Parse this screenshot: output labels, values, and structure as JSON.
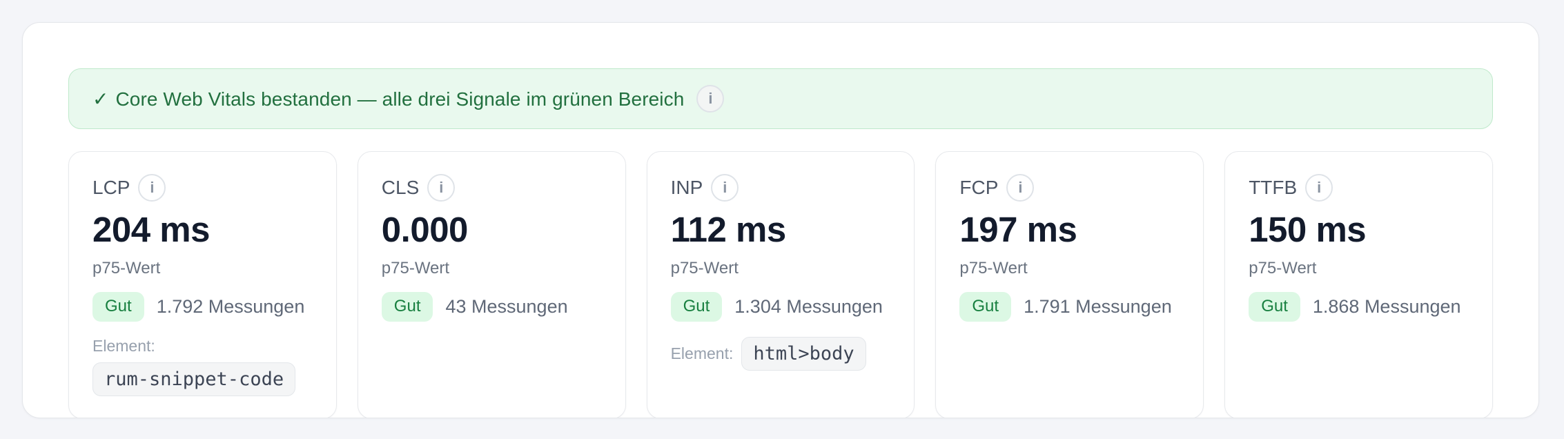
{
  "banner": {
    "check_icon": "✓",
    "text": "Core Web Vitals bestanden — alle drei Signale im grünen Bereich",
    "info_icon": "i"
  },
  "colors": {
    "page_background": "#f4f5f9",
    "panel_background": "#ffffff",
    "panel_border": "#e4e6ea",
    "banner_background": "#e9f9ee",
    "banner_border": "#bfe9cb",
    "banner_text": "#22703f",
    "badge_background": "#dcf8e4",
    "badge_text": "#177f3f",
    "value_text": "#131b2c",
    "label_text": "#4d5665",
    "muted_text": "#6a7380",
    "chip_background": "#f4f5f6"
  },
  "cards": [
    {
      "id": "lcp",
      "label": "LCP",
      "info_icon": "i",
      "value": "204 ms",
      "p75_label": "p75-Wert",
      "badge": "Gut",
      "measurements": "1.792 Messungen",
      "element_label": "Element:",
      "element_value": "rum-snippet-code"
    },
    {
      "id": "cls",
      "label": "CLS",
      "info_icon": "i",
      "value": "0.000",
      "p75_label": "p75-Wert",
      "badge": "Gut",
      "measurements": "43 Messungen"
    },
    {
      "id": "inp",
      "label": "INP",
      "info_icon": "i",
      "value": "112 ms",
      "p75_label": "p75-Wert",
      "badge": "Gut",
      "measurements": "1.304 Messungen",
      "element_label": "Element:",
      "element_value": "html>body"
    },
    {
      "id": "fcp",
      "label": "FCP",
      "info_icon": "i",
      "value": "197 ms",
      "p75_label": "p75-Wert",
      "badge": "Gut",
      "measurements": "1.791 Messungen"
    },
    {
      "id": "ttfb",
      "label": "TTFB",
      "info_icon": "i",
      "value": "150 ms",
      "p75_label": "p75-Wert",
      "badge": "Gut",
      "measurements": "1.868 Messungen"
    }
  ]
}
